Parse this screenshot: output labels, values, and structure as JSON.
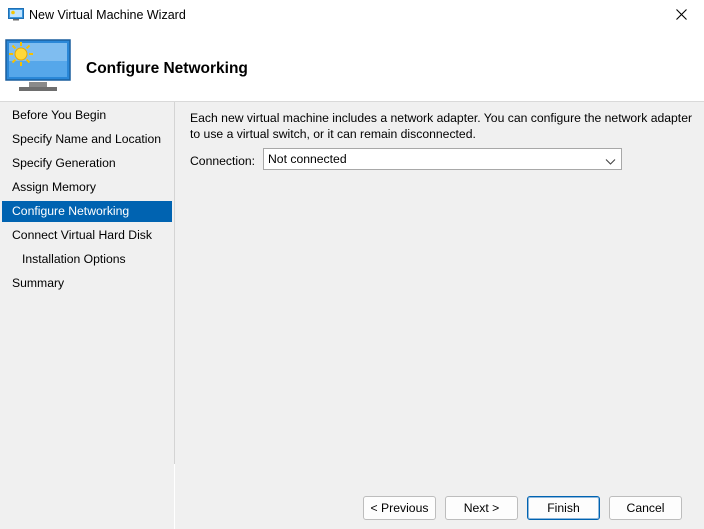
{
  "window": {
    "title": "New Virtual Machine Wizard",
    "title_icon": "monitor-icon",
    "close_icon": "close-icon"
  },
  "header": {
    "title": "Configure Networking",
    "icon": "monitor-sun-icon"
  },
  "sidebar": {
    "items": [
      {
        "label": "Before You Begin",
        "active": false
      },
      {
        "label": "Specify Name and Location",
        "active": false
      },
      {
        "label": "Specify Generation",
        "active": false
      },
      {
        "label": "Assign Memory",
        "active": false
      },
      {
        "label": "Configure Networking",
        "active": true
      },
      {
        "label": "Connect Virtual Hard Disk",
        "active": false
      },
      {
        "label": "Installation Options",
        "active": false,
        "sub": true
      },
      {
        "label": "Summary",
        "active": false
      }
    ]
  },
  "main": {
    "description": "Each new virtual machine includes a network adapter. You can configure the network adapter to use a virtual switch, or it can remain disconnected.",
    "connection_label": "Connection:",
    "connection_value": "Not connected"
  },
  "footer": {
    "previous_label": "< Previous",
    "next_label": "Next >",
    "finish_label": "Finish",
    "cancel_label": "Cancel"
  },
  "colors": {
    "accent": "#0063b1",
    "panel_background": "#f0f0f0"
  }
}
